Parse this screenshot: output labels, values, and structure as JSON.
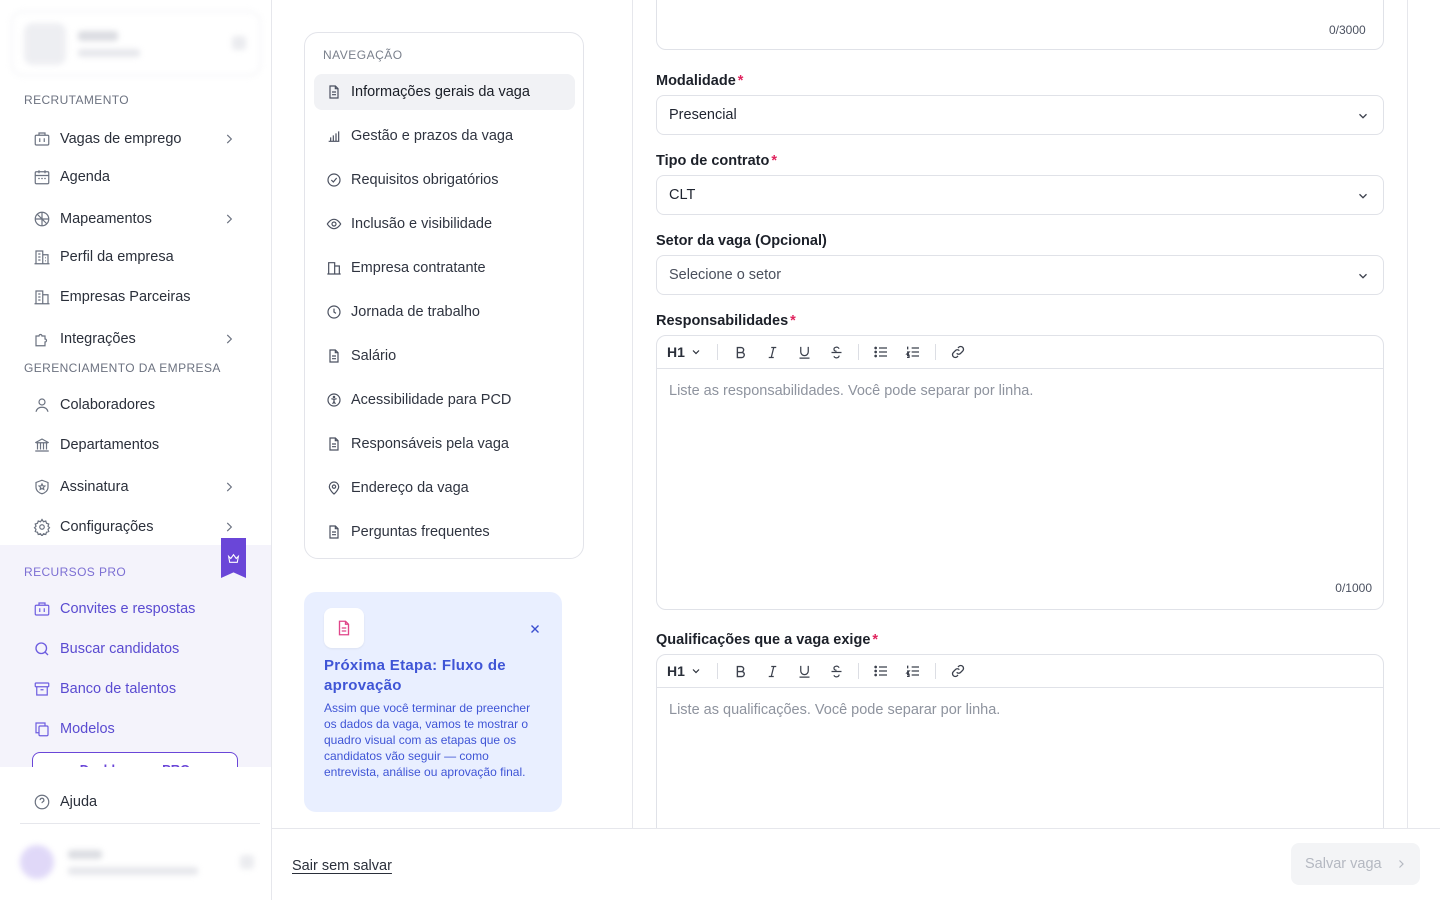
{
  "sidebar": {
    "sections": {
      "recruitment": "RECRUTAMENTO",
      "management": "GERENCIAMENTO DA EMPRESA",
      "pro": "RECURSOS PRO"
    },
    "recruitment_items": [
      {
        "label": "Vagas de emprego",
        "icon": "briefcase-icon",
        "chevron": true
      },
      {
        "label": "Agenda",
        "icon": "calendar-icon",
        "chevron": false
      },
      {
        "label": "Mapeamentos",
        "icon": "mapping-icon",
        "chevron": true
      },
      {
        "label": "Perfil da empresa",
        "icon": "building-icon",
        "chevron": false
      },
      {
        "label": "Empresas Parceiras",
        "icon": "buildings-icon",
        "chevron": false
      },
      {
        "label": "Integrações",
        "icon": "puzzle-icon",
        "chevron": true
      }
    ],
    "management_items": [
      {
        "label": "Colaboradores",
        "icon": "user-icon",
        "chevron": false
      },
      {
        "label": "Departamentos",
        "icon": "bank-icon",
        "chevron": false
      },
      {
        "label": "Assinatura",
        "icon": "shield-icon",
        "chevron": true
      },
      {
        "label": "Configurações",
        "icon": "gear-icon",
        "chevron": true
      }
    ],
    "pro_items": [
      {
        "label": "Convites e respostas",
        "icon": "briefcase-icon"
      },
      {
        "label": "Buscar candidatos",
        "icon": "search-icon"
      },
      {
        "label": "Banco de talentos",
        "icon": "archive-icon"
      },
      {
        "label": "Modelos",
        "icon": "copy-icon"
      }
    ],
    "pro_button": "Desbloquear PRO",
    "help": "Ajuda",
    "accent": "#6a46d8"
  },
  "navigation": {
    "title": "NAVEGAÇÃO",
    "items": [
      {
        "label": "Informações gerais da vaga",
        "icon": "document-icon",
        "active": true
      },
      {
        "label": "Gestão e prazos da vaga",
        "icon": "bar-chart-icon"
      },
      {
        "label": "Requisitos obrigatórios",
        "icon": "check-circle-icon"
      },
      {
        "label": "Inclusão e visibilidade",
        "icon": "eye-icon"
      },
      {
        "label": "Empresa contratante",
        "icon": "building-icon"
      },
      {
        "label": "Jornada de trabalho",
        "icon": "clock-icon"
      },
      {
        "label": "Salário",
        "icon": "document-icon"
      },
      {
        "label": "Acessibilidade para PCD",
        "icon": "accessibility-icon"
      },
      {
        "label": "Responsáveis pela vaga",
        "icon": "document-icon"
      },
      {
        "label": "Endereço da vaga",
        "icon": "map-pin-icon"
      },
      {
        "label": "Perguntas frequentes",
        "icon": "document-icon"
      }
    ]
  },
  "info_card": {
    "title": "Próxima Etapa: Fluxo de aprovação",
    "text": "Assim que você terminar de preencher os dados da vaga, vamos te mostrar o quadro visual com as etapas que os candidatos vão seguir — como entrevista, análise ou aprovação final.",
    "accent": "#3f55d6",
    "background": "#e9efff"
  },
  "form": {
    "description_counter": "0/3000",
    "modality": {
      "label": "Modalidade",
      "value": "Presencial"
    },
    "contract": {
      "label": "Tipo de contrato",
      "value": "CLT"
    },
    "sector": {
      "label": "Setor da vaga (Opcional)",
      "placeholder": "Selecione o setor"
    },
    "responsibilities": {
      "label": "Responsabilidades",
      "placeholder": "Liste as responsabilidades. Você pode separar por linha.",
      "counter": "0/1000"
    },
    "qualifications": {
      "label": "Qualificações que a vaga exige",
      "placeholder": "Liste as qualificações. Você pode separar por linha."
    },
    "toolbar": {
      "heading": "H1"
    },
    "required_mark": "*",
    "required_color": "#e0245e"
  },
  "footer": {
    "exit": "Sair sem salvar",
    "save": "Salvar vaga"
  }
}
